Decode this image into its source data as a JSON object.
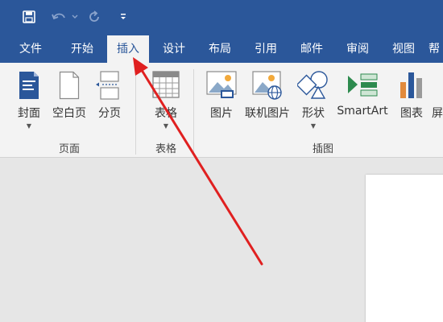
{
  "tabs": [
    {
      "label": "文件"
    },
    {
      "label": "开始"
    },
    {
      "label": "插入",
      "active": true
    },
    {
      "label": "设计"
    },
    {
      "label": "布局"
    },
    {
      "label": "引用"
    },
    {
      "label": "邮件"
    },
    {
      "label": "审阅"
    },
    {
      "label": "视图"
    },
    {
      "label": "帮"
    }
  ],
  "ribbon": {
    "pages": {
      "group_label": "页面",
      "cover": "封面",
      "blank_page": "空白页",
      "page_break": "分页"
    },
    "tables": {
      "group_label": "表格",
      "table": "表格"
    },
    "illustrations": {
      "group_label": "插图",
      "pictures": "图片",
      "online_pictures": "联机图片",
      "shapes": "形状",
      "smartart": "SmartArt",
      "chart": "图表",
      "screenshot": "屏"
    }
  },
  "colors": {
    "accent": "#2b579a",
    "ribbon_bg": "#f3f3f3",
    "doc_bg": "#e6e6e6",
    "arrow": "#e02020"
  },
  "icons": {
    "save": "save-icon",
    "undo": "undo-icon",
    "redo": "redo-icon",
    "customize": "customize-qat-icon"
  }
}
